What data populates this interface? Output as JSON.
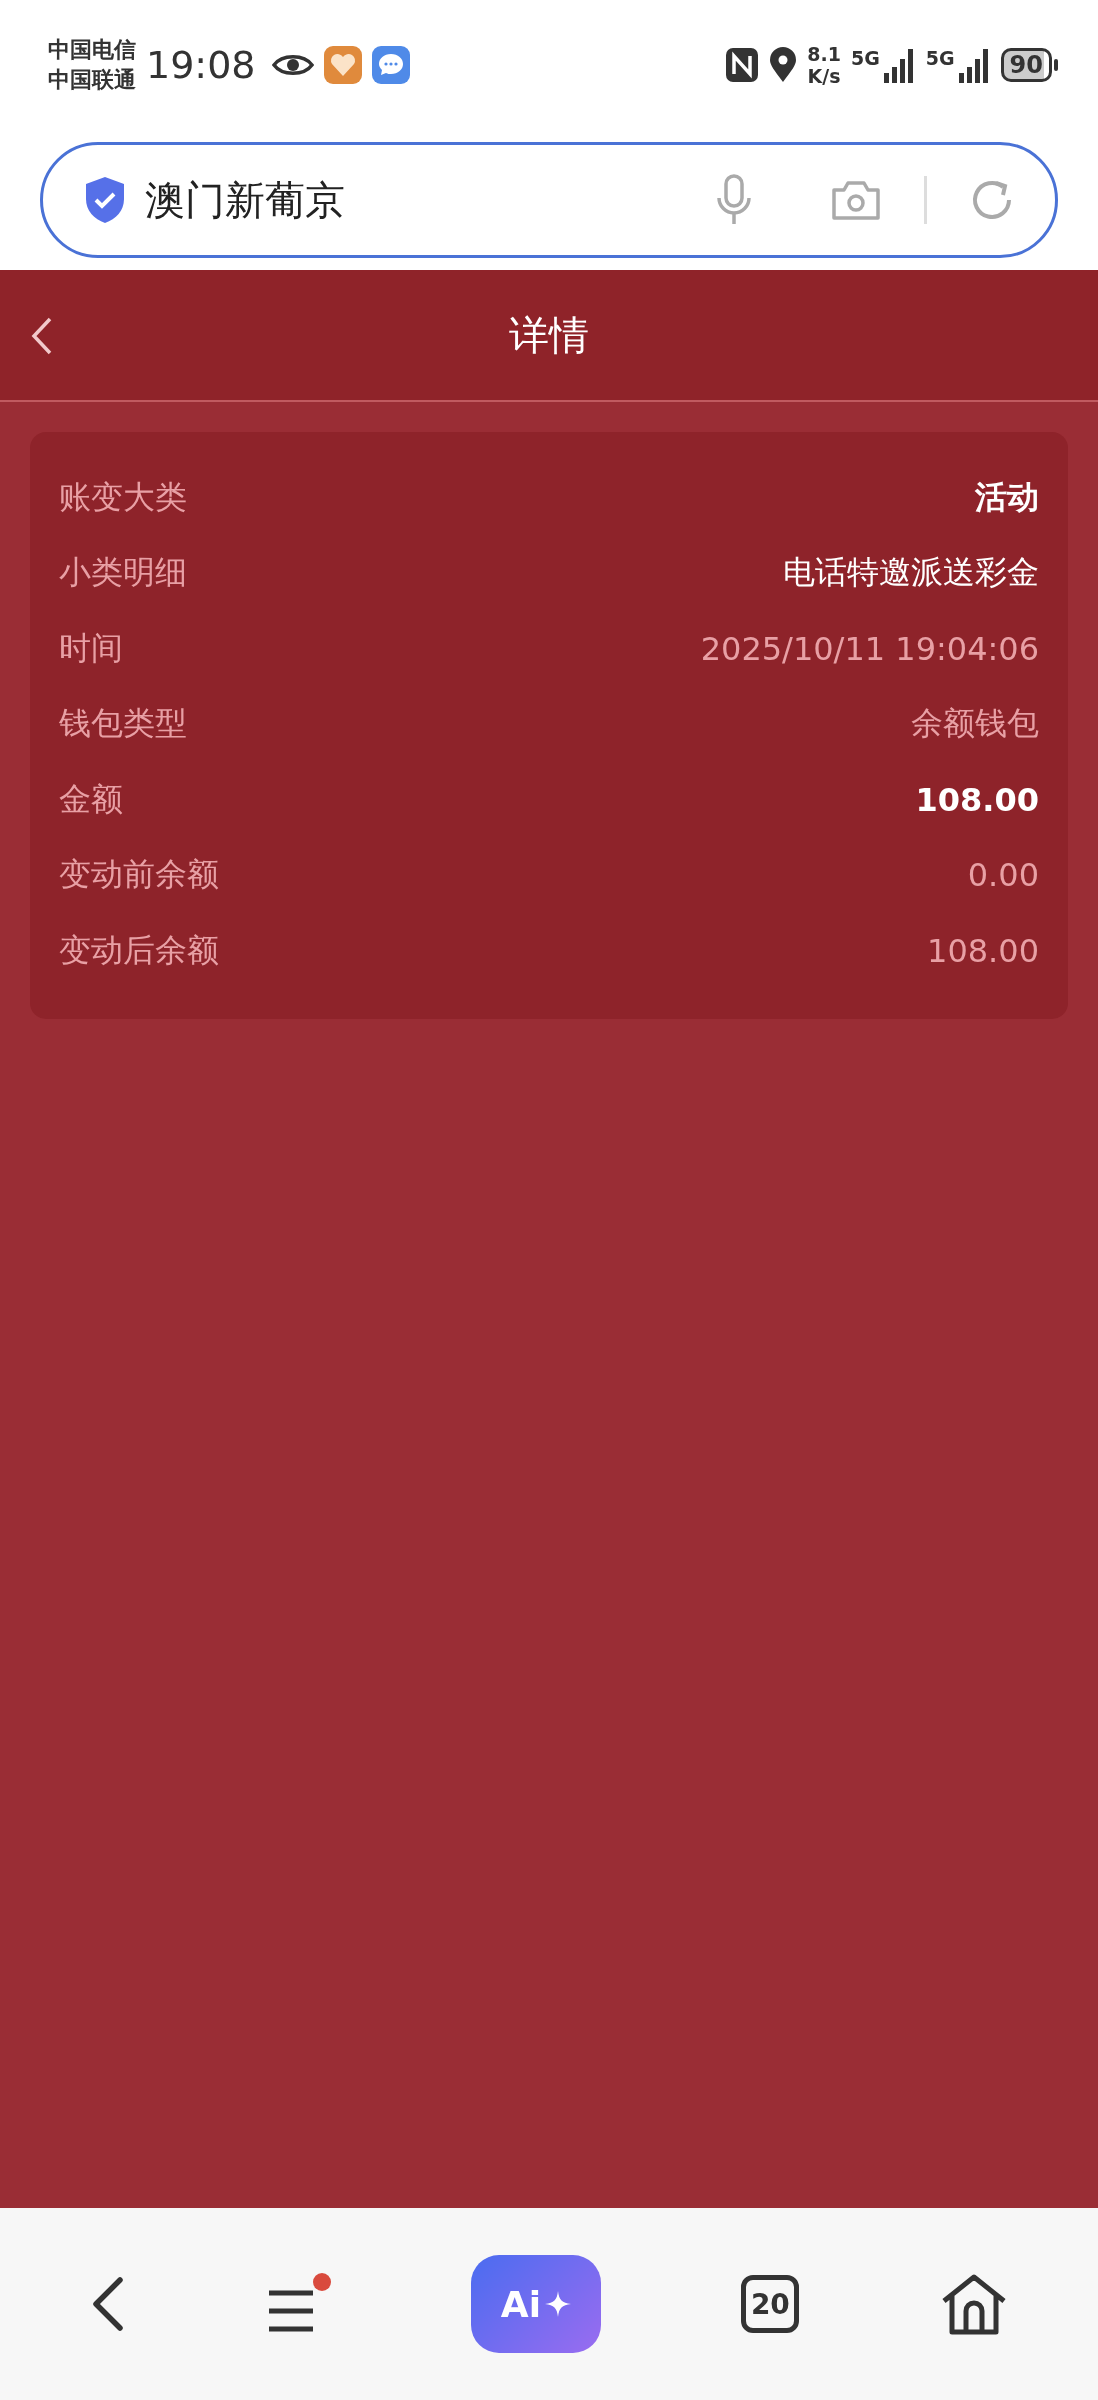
{
  "status_bar": {
    "carriers": [
      "中国电信",
      "中国联通"
    ],
    "time": "19:08",
    "speed_value": "8.1",
    "speed_unit": "K/s",
    "networks": [
      "5G",
      "5G"
    ],
    "battery": "90"
  },
  "search_bar": {
    "value": "澳门新葡京"
  },
  "header": {
    "title": "详情"
  },
  "details": [
    {
      "label": "账变大类",
      "value": "活动",
      "kind": "strong"
    },
    {
      "label": "小类明细",
      "value": "电话特邀派送彩金",
      "kind": "bright"
    },
    {
      "label": "时间",
      "value": "2025/10/11 19:04:06",
      "kind": "muted"
    },
    {
      "label": "钱包类型",
      "value": "余额钱包",
      "kind": "muted"
    },
    {
      "label": "金额",
      "value": "108.00",
      "kind": "strong"
    },
    {
      "label": "变动前余额",
      "value": "0.00",
      "kind": "muted"
    },
    {
      "label": "变动后余额",
      "value": "108.00",
      "kind": "muted"
    }
  ],
  "bottom_nav": {
    "menu_badge": true,
    "ai_label": "Ai",
    "tab_count": "20"
  }
}
